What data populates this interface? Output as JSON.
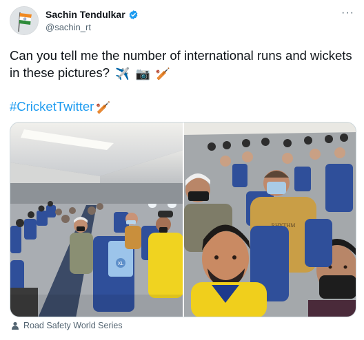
{
  "author": {
    "display_name": "Sachin Tendulkar",
    "handle": "@sachin_rt",
    "verified": true
  },
  "tweet": {
    "text": "Can you tell me the number of international runs and wickets in these pictures?",
    "emojis": [
      "✈️",
      "📷",
      "🏏"
    ],
    "hashtag": "#CricketTwitter",
    "hashtag_emoji": "🏏"
  },
  "menu": {
    "more_label": "···"
  },
  "photos": {
    "seat_label": "XL",
    "shirt_text": "RHYTHM"
  },
  "tagged": {
    "label": "Road Safety World Series"
  },
  "colors": {
    "link": "#1d9bf0",
    "secondary_text": "#536471",
    "verified": "#1d9bf0"
  }
}
